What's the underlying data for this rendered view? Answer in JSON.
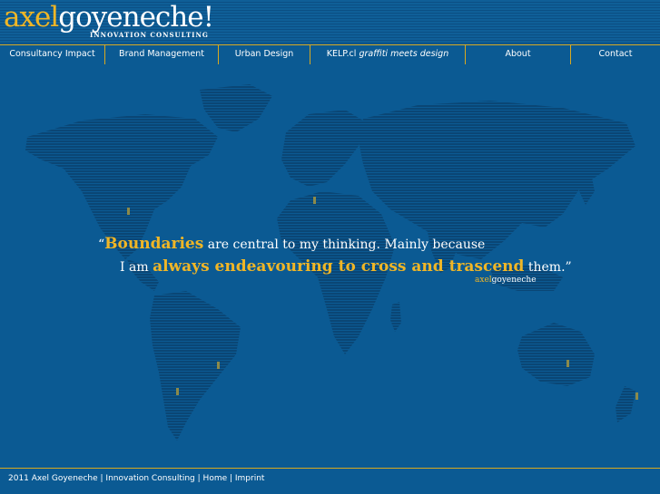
{
  "brand": {
    "first": "axel",
    "last": "goyeneche!",
    "tagline": "INNOVATION CONSULTING"
  },
  "nav": [
    {
      "label": "Consultancy Impact"
    },
    {
      "label": "Brand Management"
    },
    {
      "label": "Urban Design"
    },
    {
      "label_prefix": "KELP.cl ",
      "label_italic": "graffiti meets design"
    },
    {
      "label": "About"
    },
    {
      "label": "Contact"
    }
  ],
  "quote": {
    "open": "“",
    "word1": "Boundaries",
    "text1": " are central to my thinking. Mainly because",
    "text2a": "I am ",
    "word2": "always endeavouring to cross and trascend",
    "text2b": " them.”",
    "sig_first": "axel",
    "sig_last": "goyeneche"
  },
  "footer": {
    "copyright": "2011 Axel Goyeneche",
    "sep1": " | ",
    "company": "Innovation Consulting",
    "sep2": " | ",
    "home": "Home",
    "sep3": " | ",
    "imprint": "Imprint"
  },
  "colors": {
    "background": "#0b5a93",
    "accent": "#f0b626",
    "land": "#0a4777"
  }
}
